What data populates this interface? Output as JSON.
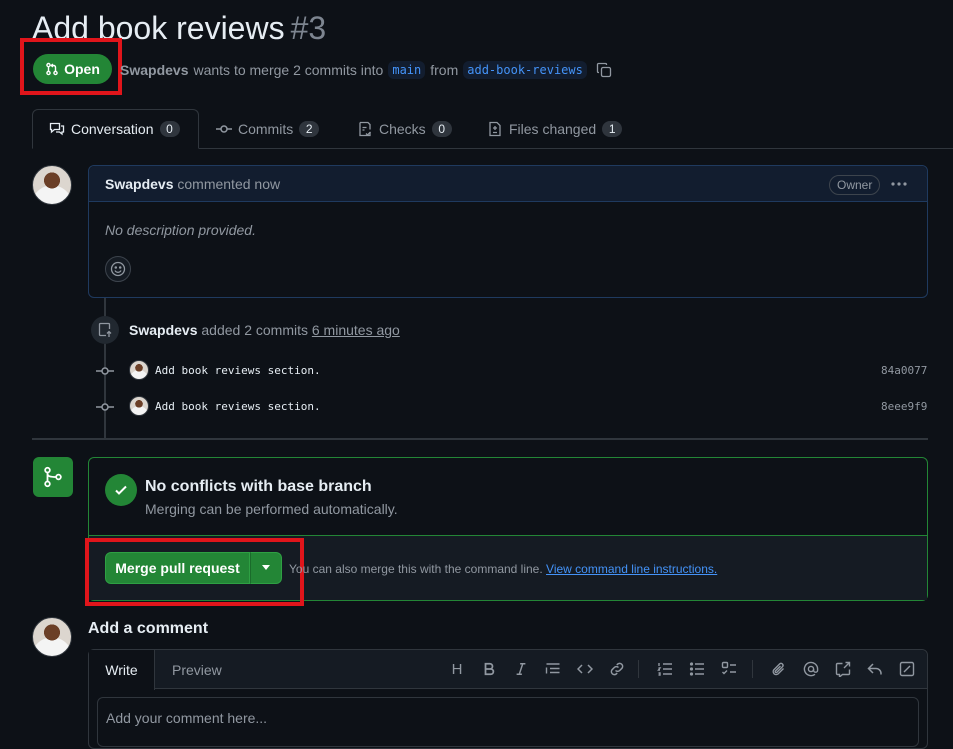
{
  "pr": {
    "title": "Add book reviews",
    "number": "#3",
    "state": "Open",
    "author": "Swapdevs",
    "merge_text": "wants to merge 2 commits into",
    "base_branch": "main",
    "from_text": "from",
    "head_branch": "add-book-reviews"
  },
  "tabs": [
    {
      "label": "Conversation",
      "count": "0"
    },
    {
      "label": "Commits",
      "count": "2"
    },
    {
      "label": "Checks",
      "count": "0"
    },
    {
      "label": "Files changed",
      "count": "1"
    }
  ],
  "comment": {
    "author": "Swapdevs",
    "meta": "commented now",
    "role": "Owner",
    "body": "No description provided."
  },
  "commits_event": {
    "author": "Swapdevs",
    "text": "added 2 commits",
    "time": "6 minutes ago",
    "commits": [
      {
        "message": "Add book reviews section.",
        "sha": "84a0077"
      },
      {
        "message": "Add book reviews section.",
        "sha": "8eee9f9"
      }
    ]
  },
  "merge": {
    "title": "No conflicts with base branch",
    "subtitle": "Merging can be performed automatically.",
    "button": "Merge pull request",
    "cli_text": "You can also merge this with the command line.",
    "cli_link": "View command line instructions."
  },
  "add_comment": {
    "heading": "Add a comment",
    "tab_write": "Write",
    "tab_preview": "Preview",
    "placeholder": "Add your comment here...",
    "toolbar_heading_glyph": "H"
  },
  "colors": {
    "accent_green": "#238636",
    "link_blue": "#4493f8",
    "highlight_red": "#e0151b"
  }
}
